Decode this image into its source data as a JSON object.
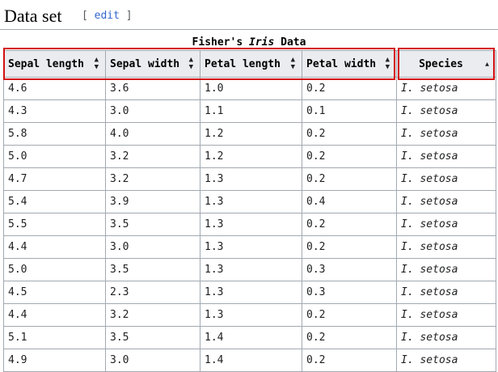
{
  "section": {
    "title": "Data set",
    "edit_open": "[ ",
    "edit_label": "edit",
    "edit_close": " ]"
  },
  "caption": {
    "prefix": "Fisher's ",
    "italic": "Iris",
    "suffix": " Data"
  },
  "table": {
    "columns": [
      "Sepal length",
      "Sepal width",
      "Petal length",
      "Petal width",
      "Species"
    ],
    "sort_indicators": {
      "sortable": "both",
      "species": "ascending"
    },
    "rows": [
      [
        "4.6",
        "3.6",
        "1.0",
        "0.2",
        "I. setosa"
      ],
      [
        "4.3",
        "3.0",
        "1.1",
        "0.1",
        "I. setosa"
      ],
      [
        "5.8",
        "4.0",
        "1.2",
        "0.2",
        "I. setosa"
      ],
      [
        "5.0",
        "3.2",
        "1.2",
        "0.2",
        "I. setosa"
      ],
      [
        "4.7",
        "3.2",
        "1.3",
        "0.2",
        "I. setosa"
      ],
      [
        "5.4",
        "3.9",
        "1.3",
        "0.4",
        "I. setosa"
      ],
      [
        "5.5",
        "3.5",
        "1.3",
        "0.2",
        "I. setosa"
      ],
      [
        "4.4",
        "3.0",
        "1.3",
        "0.2",
        "I. setosa"
      ],
      [
        "5.0",
        "3.5",
        "1.3",
        "0.3",
        "I. setosa"
      ],
      [
        "4.5",
        "2.3",
        "1.3",
        "0.3",
        "I. setosa"
      ],
      [
        "4.4",
        "3.2",
        "1.3",
        "0.2",
        "I. setosa"
      ],
      [
        "5.1",
        "3.5",
        "1.4",
        "0.2",
        "I. setosa"
      ],
      [
        "4.9",
        "3.0",
        "1.4",
        "0.2",
        "I. setosa"
      ]
    ]
  },
  "colors": {
    "highlight": "#d30f0f",
    "header_bg": "#eaecf0",
    "border": "#a2a9b1",
    "link": "#3366cc"
  }
}
